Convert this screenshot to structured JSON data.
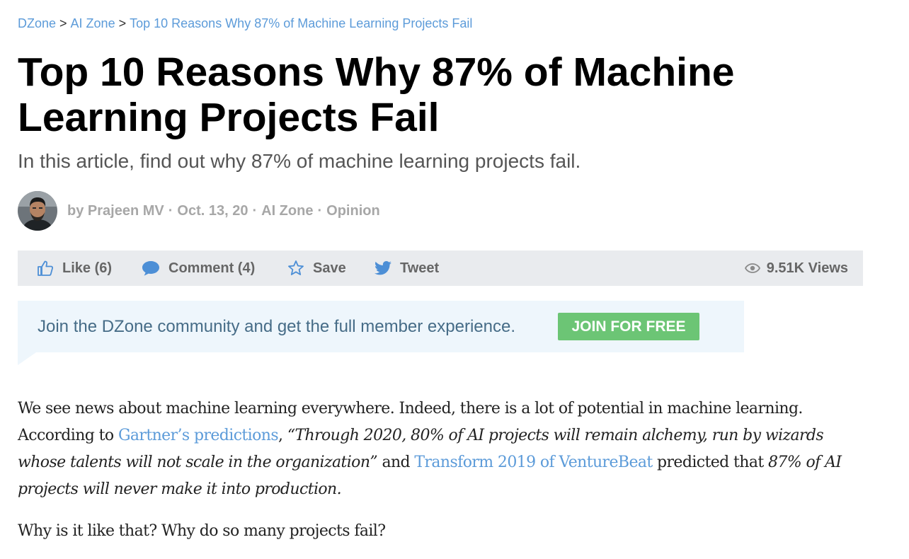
{
  "breadcrumb": {
    "items": [
      "DZone",
      "AI Zone",
      "Top 10 Reasons Why 87% of Machine Learning Projects Fail"
    ],
    "separator": ">"
  },
  "article": {
    "title": "Top 10 Reasons Why 87% of Machine Learning Projects Fail",
    "subtitle": "In this article, find out why 87% of machine learning projects fail.",
    "author": "by Prajeen MV",
    "date": "Oct. 13, 20",
    "zone": "AI Zone",
    "category": "Opinion",
    "meta_separator": "·"
  },
  "actions": {
    "like_label": "Like (6)",
    "comment_label": "Comment (4)",
    "save_label": "Save",
    "tweet_label": "Tweet",
    "views_label": "9.51K Views"
  },
  "banner": {
    "text": "Join the DZone community and get the full member experience.",
    "button_label": "JOIN FOR FREE"
  },
  "body": {
    "p1_intro": "We see news about machine learning everywhere. Indeed, there is a lot of potential in machine learning. According to ",
    "link1": "Gartner’s predictions",
    "p1_comma": ", ",
    "quote": "“Through 2020, 80% of AI projects will remain alchemy, run by wizards whose talents will not scale in the organization”",
    "and": " and ",
    "link2": "Transform 2019 of VentureBeat",
    "predicted": " predicted that ",
    "claim": "87% of AI projects will never make it into production.",
    "p2": "Why is it like that? Why do so many projects fail?"
  },
  "colors": {
    "link": "#5c9bd9",
    "join_button": "#6cc575",
    "banner_bg": "#eef6fc",
    "action_bar_bg": "#e9ebee",
    "meta_gray": "#a7a7a7"
  },
  "icons": {
    "like": "thumbs-up-icon",
    "comment": "comment-bubble-icon",
    "save": "star-icon",
    "tweet": "twitter-bird-icon",
    "views": "eye-icon"
  }
}
